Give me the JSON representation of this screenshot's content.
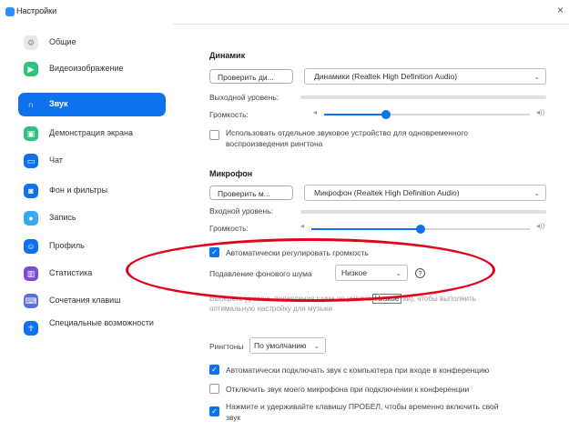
{
  "window": {
    "title": "Настройки",
    "close_glyph": "×"
  },
  "sidebar": {
    "items": [
      {
        "label": "Общие",
        "icon": "gear-icon",
        "color": "#e8e8e8"
      },
      {
        "label": "Видеоизображение",
        "icon": "video-icon",
        "color": "#2ec27e"
      },
      {
        "label": "Звук",
        "icon": "headphones-icon",
        "color": "#0e72ed"
      },
      {
        "label": "Демонстрация экрана",
        "icon": "screen-share-icon",
        "color": "#2ec27e"
      },
      {
        "label": "Чат",
        "icon": "chat-icon",
        "color": "#0e72ed"
      },
      {
        "label": "Фон и фильтры",
        "icon": "background-icon",
        "color": "#0e72ed"
      },
      {
        "label": "Запись",
        "icon": "record-icon",
        "color": "#3aa8f0"
      },
      {
        "label": "Профиль",
        "icon": "profile-icon",
        "color": "#0e72ed"
      },
      {
        "label": "Статистика",
        "icon": "statistics-icon",
        "color": "#7a4dd6"
      },
      {
        "label": "Сочетания клавиш",
        "icon": "keyboard-icon",
        "color": "#5a6dd8"
      },
      {
        "label": "Специальные возможности",
        "icon": "accessibility-icon",
        "color": "#0e72ed"
      }
    ]
  },
  "speaker": {
    "heading": "Динамик",
    "test_button": "Проверить ди...",
    "device": "Динамики (Realtek High Definition Audio)",
    "output_level_label": "Выходной уровень:",
    "volume_label": "Громкость:",
    "volume_fraction": 0.3,
    "separate_device_label": "Использовать отдельное звуковое устройство для одновременного",
    "separate_device_label_2": "воспроизведения рингтона",
    "separate_device_checked": false
  },
  "microphone": {
    "heading": "Микрофон",
    "test_button": "Проверить м...",
    "device": "Микрофон (Realtek High Definition Audio)",
    "input_level_label": "Входной уровень:",
    "volume_label": "Громкость:",
    "volume_fraction": 0.5,
    "auto_adjust_label": "Автоматически регулировать громкость",
    "auto_adjust_checked": true,
    "noise_label": "Подавление фонового шума",
    "noise_value": "Низкое",
    "noise_hint_1": "Выберете уровень подавления шума по умолча",
    "noise_hint_tooltip": "Низкое",
    "noise_hint_1b": "ий), чтобы выполнить",
    "noise_hint_2": "оптимальную настройку для музыки"
  },
  "ringtone": {
    "label": "Рингтоны",
    "value": "По умолчанию"
  },
  "options": [
    {
      "label": "Автоматически подключать звук с компьютера при входе в конференцию",
      "checked": true
    },
    {
      "label": "Отключить звук моего микрофона при подключении к конференции",
      "checked": false
    },
    {
      "label": "Нажмите и удерживайте клавишу ПРОБЕЛ, чтобы временно включить свой",
      "label2": "звук",
      "checked": true
    }
  ],
  "annotation_color": "#e3001b"
}
